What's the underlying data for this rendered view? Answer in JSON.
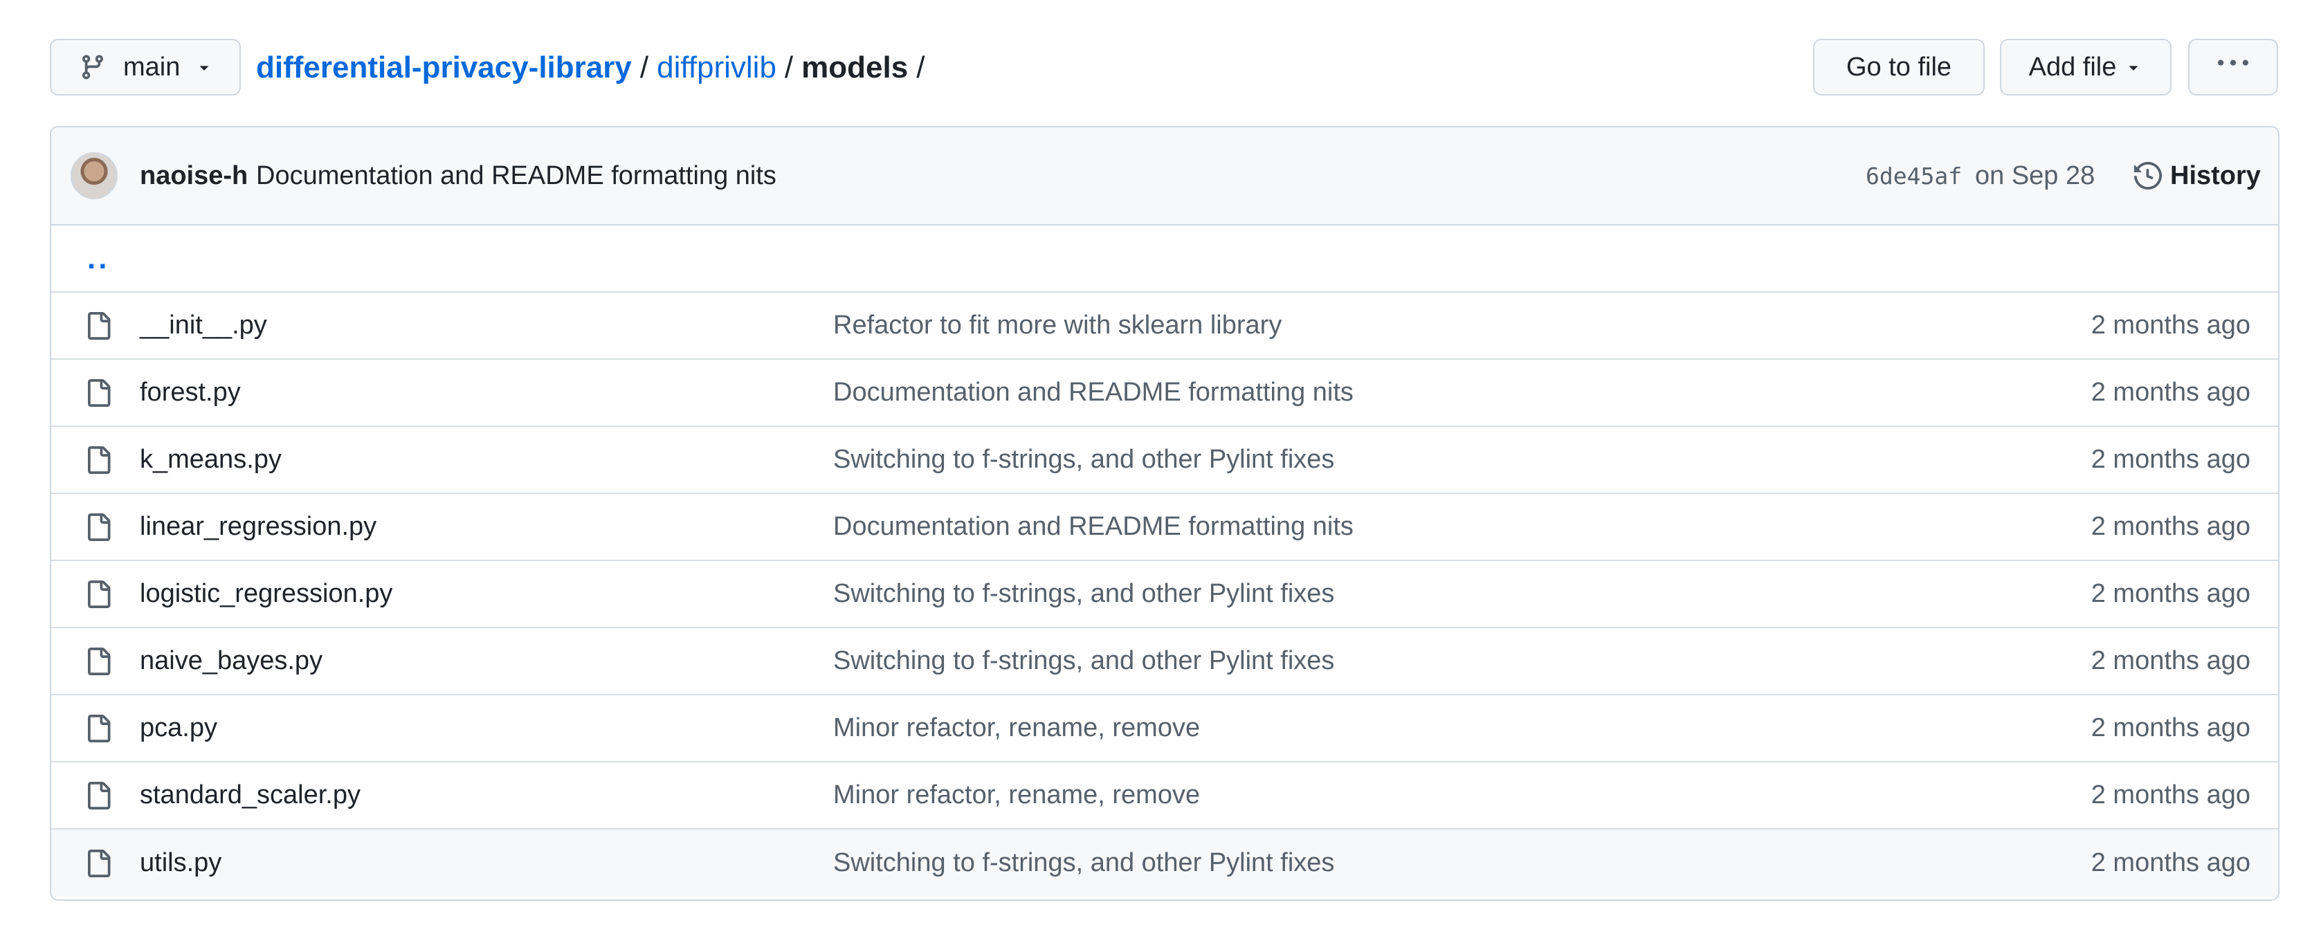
{
  "branch": {
    "name": "main",
    "icon": "git-branch-icon"
  },
  "breadcrumb": {
    "repo": "differential-privacy-library",
    "folder": "diffprivlib",
    "current": "models",
    "separator": "/"
  },
  "actions": {
    "go_to_file": "Go to file",
    "add_file": "Add file",
    "more": "···"
  },
  "latest_commit": {
    "author": "naoise-h",
    "message": "Documentation and README formatting nits",
    "sha": "6de45af",
    "date": "on Sep 28",
    "history_label": "History"
  },
  "parent_dir": "..",
  "files": [
    {
      "name": "__init__.py",
      "commit": "Refactor to fit more with sklearn library",
      "age": "2 months ago"
    },
    {
      "name": "forest.py",
      "commit": "Documentation and README formatting nits",
      "age": "2 months ago"
    },
    {
      "name": "k_means.py",
      "commit": "Switching to f-strings, and other Pylint fixes",
      "age": "2 months ago"
    },
    {
      "name": "linear_regression.py",
      "commit": "Documentation and README formatting nits",
      "age": "2 months ago"
    },
    {
      "name": "logistic_regression.py",
      "commit": "Switching to f-strings, and other Pylint fixes",
      "age": "2 months ago"
    },
    {
      "name": "naive_bayes.py",
      "commit": "Switching to f-strings, and other Pylint fixes",
      "age": "2 months ago"
    },
    {
      "name": "pca.py",
      "commit": "Minor refactor, rename, remove",
      "age": "2 months ago"
    },
    {
      "name": "standard_scaler.py",
      "commit": "Minor refactor, rename, remove",
      "age": "2 months ago"
    },
    {
      "name": "utils.py",
      "commit": "Switching to f-strings, and other Pylint fixes",
      "age": "2 months ago"
    }
  ],
  "colors": {
    "link": "#0969da",
    "text": "#1f2328",
    "muted": "#57606a",
    "border": "#d0d7de",
    "header_bg": "#f6f8fa"
  }
}
